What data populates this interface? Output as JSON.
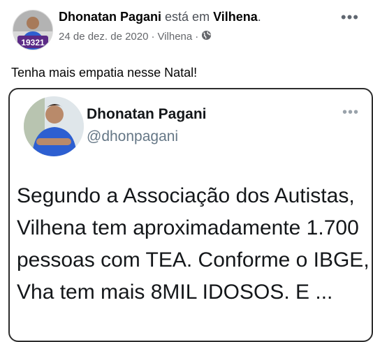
{
  "post": {
    "author_name": "Dhonatan Pagani",
    "connector": "está em",
    "location": "Vilhena",
    "location_punct": ".",
    "date": "24 de dez. de 2020",
    "meta_separator": "·",
    "meta_location": "Vilhena",
    "privacy_icon": "globe-icon",
    "more_icon": "more-horizontal-icon",
    "more_label": "•••",
    "caption": "Tenha mais empatia nesse Natal!",
    "avatar_badge": "19321"
  },
  "tweet": {
    "name": "Dhonatan Pagani",
    "handle": "@dhonpagani",
    "more_label": "•••",
    "text": "Segundo a Associação dos Autistas, Vilhena tem aproximadamente 1.700 pessoas com TEA. Conforme o IBGE, Vha tem mais 8MIL IDOSOS. E ..."
  },
  "colors": {
    "badge_purple": "#5b2a86",
    "shirt_blue": "#2d5fd1",
    "muted_text": "#65676b",
    "handle_gray": "#657786"
  }
}
